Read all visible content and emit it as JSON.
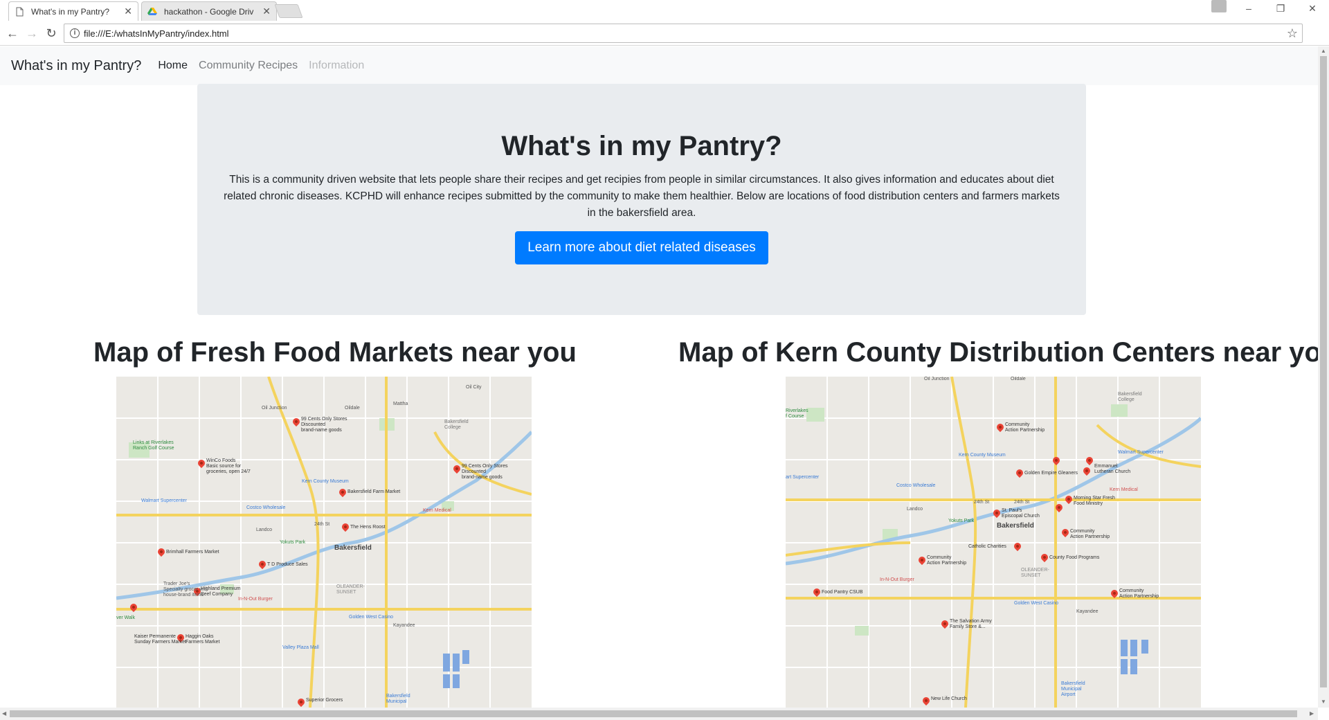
{
  "browser": {
    "tabs": [
      {
        "title": "What's in my Pantry?",
        "active": true
      },
      {
        "title": "hackathon - Google Driv",
        "active": false
      }
    ],
    "url": "file:///E:/whatsInMyPantry/index.html",
    "window_controls": {
      "minimize": "–",
      "restore": "❐",
      "close": "✕"
    }
  },
  "navbar": {
    "brand": "What's in my Pantry?",
    "links": [
      "Home",
      "Community Recipes",
      "Information"
    ]
  },
  "jumbotron": {
    "title": "What's in my Pantry?",
    "description": "This is a community driven website that lets people share their recipes and get recipies from people in similar circumstances. It also gives information and educates about diet related chronic diseases. KCPHD will enhance recipes submitted by the community to make them healthier. Below are locations of food distribution centers and farmers markets in the bakersfield area.",
    "button_label": "Learn more about diet related diseases"
  },
  "maps": {
    "left": {
      "title": "Map of Fresh Food Markets near you",
      "city": "Bakersfield",
      "pins": [
        "99 Cents Only Stores\nDiscounted\nbrand-name goods",
        "WinCo Foods\nBasic source for\ngroceries, open 24/7",
        "99 Cents Only Stores\nDiscounted\nbrand-name goods",
        "Bakersfield Farm Market",
        "The Hens Roost",
        "Brimhall Farmers Market",
        "T D Produce Sales",
        "Highland Premium\nBeef Company",
        "Haggin Oaks\nFarmers Market",
        "Superior Grocers"
      ],
      "places": [
        "Oil City",
        "Oil Junction",
        "Oildale",
        "Mattha",
        "Bakersfield\nCollege",
        "Links at Riverlakes\nRanch Golf Course",
        "Kern County Museum",
        "Walmart Supercenter",
        "Costco Wholesale",
        "Kern Medical",
        "Landco",
        "Yokuts Park",
        "24th St",
        "Trader Joe's\nSpecialty grocer with\nhouse-brand items",
        "In-N-Out Burger",
        "OLEANDER-\nSUNSET",
        "Golden West Casino",
        "Kaiser Permanente\nSunday Farmers Market",
        "Kayandee",
        "Valley Plaza Mall",
        "Bakersfield\nMunicipal",
        "ver Walk"
      ]
    },
    "right": {
      "title": "Map of Kern County Distribution Centers near you",
      "city": "Bakersfield",
      "pins": [
        "Community\nAction Partnership",
        "Golden Empire Gleaners",
        "Emmanuel\nLutheran Church",
        "Morning Star Fresh\nFood Ministry",
        "St. Paul's\nEpiscopal Church",
        "Community\nAction Partnership",
        "Catholic Charities",
        "Community\nAction Partnership",
        "County Food Programs",
        "Food Pantry CSUB",
        "Community\nAction Partnership",
        "The Salvation Army\nFamily Store &...",
        "New Life Church"
      ],
      "places": [
        "Oil Junction",
        "Oildale",
        "Bakersfield\nCollege",
        "Riverlakes\nf Course",
        "Kern County Museum",
        "Walmart Supercenter",
        "art Supercenter",
        "Costco Wholesale",
        "Kern Medical",
        "Landco",
        "Yokuts Park",
        "24th St",
        "24th St",
        "In-N-Out Burger",
        "OLEANDER-\nSUNSET",
        "Golden West Casino",
        "Kayandee",
        "Bakersfield\nMunicipal\nAirport"
      ]
    }
  },
  "colors": {
    "primary": "#007bff",
    "jumbotron_bg": "#e9ecef",
    "navbar_bg": "#f8f9fa",
    "map_pin": "#ea4335"
  }
}
